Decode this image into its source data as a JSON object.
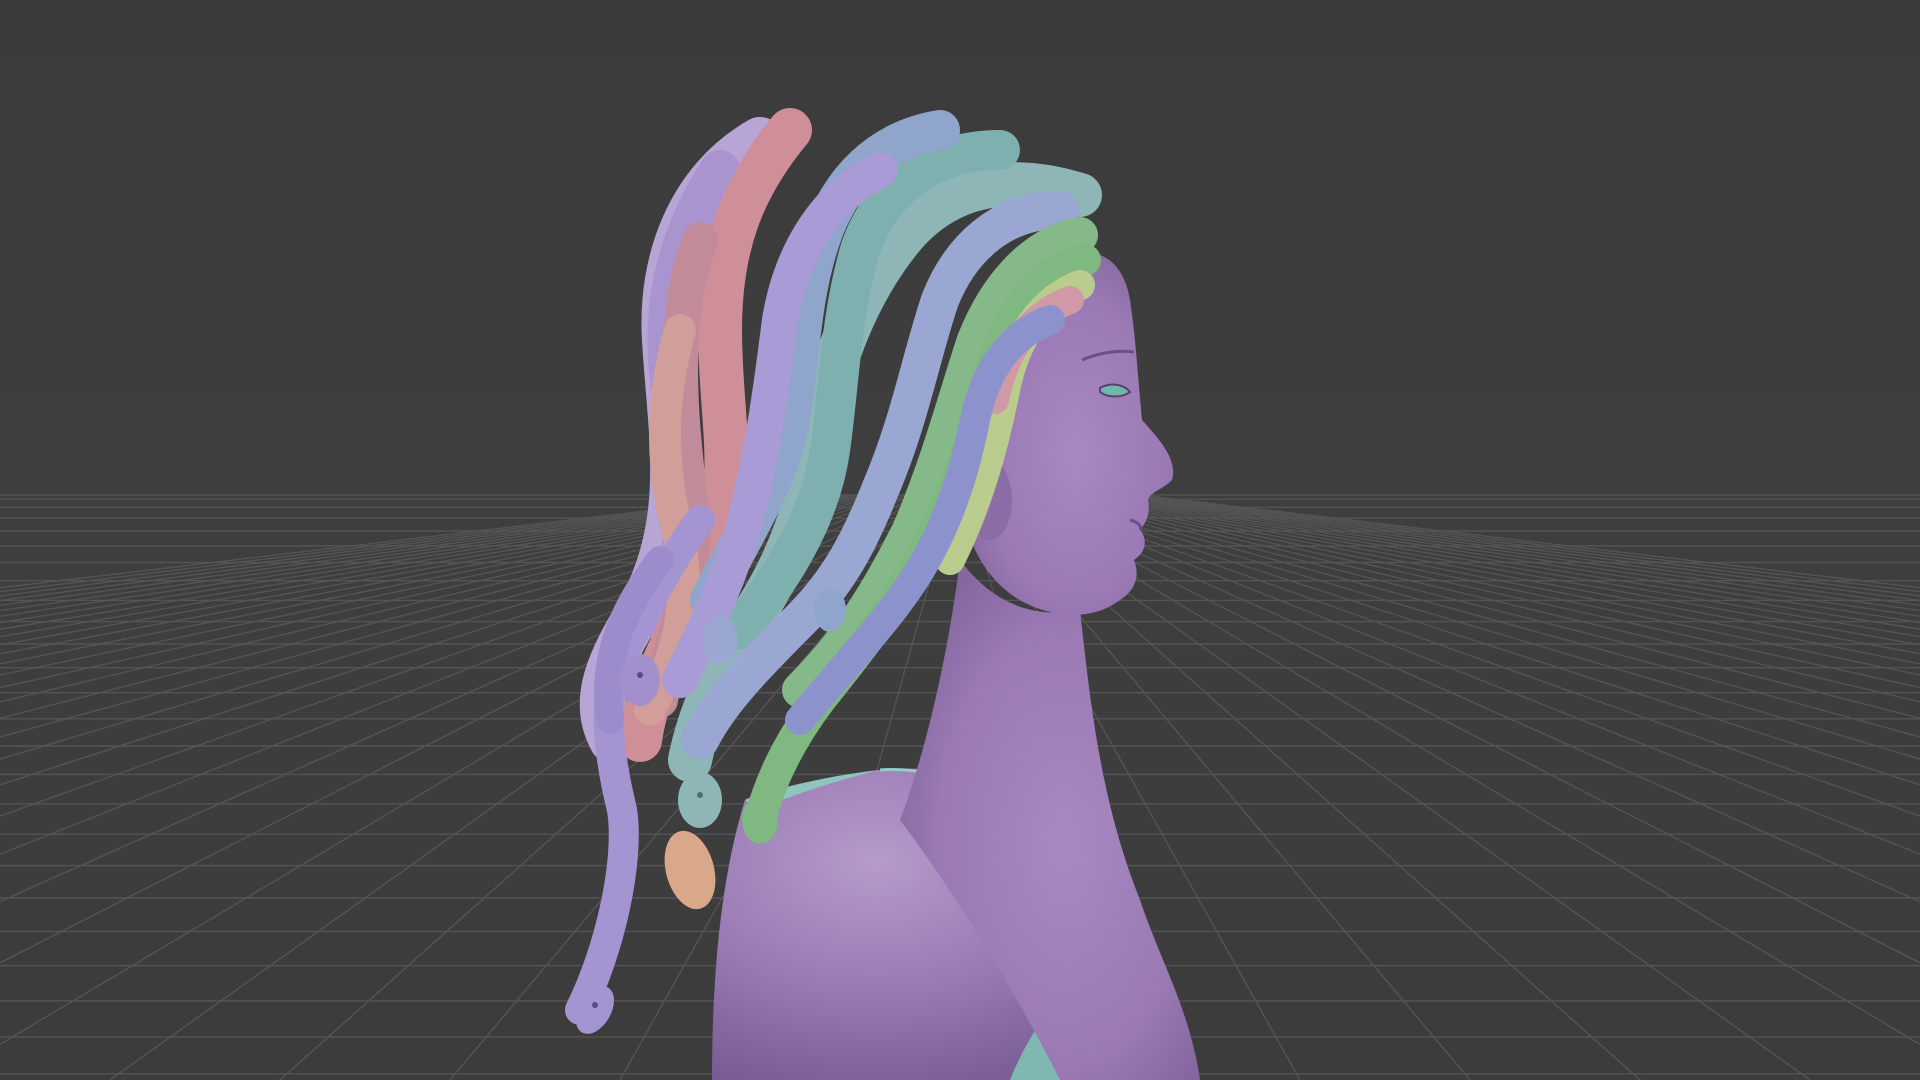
{
  "app": {
    "viewport_label": ""
  },
  "scene": {
    "subject": "sculpt-medusa-bust",
    "icons": {
      "model": "sculpt-model-icon"
    },
    "colors": {
      "background": "#3d3d3d",
      "grid": "#565656",
      "skin": "#9b79b5",
      "skin_shadow": "#7f629a",
      "garment": "#7fb7b1",
      "snake_lavender": "#9a8cc8",
      "snake_blue": "#8fa5cc",
      "snake_teal": "#7fb0b0",
      "snake_green": "#86b98a",
      "snake_lime": "#b9cc8e",
      "snake_pink": "#cf8f99",
      "snake_peach": "#d9a88b"
    }
  }
}
